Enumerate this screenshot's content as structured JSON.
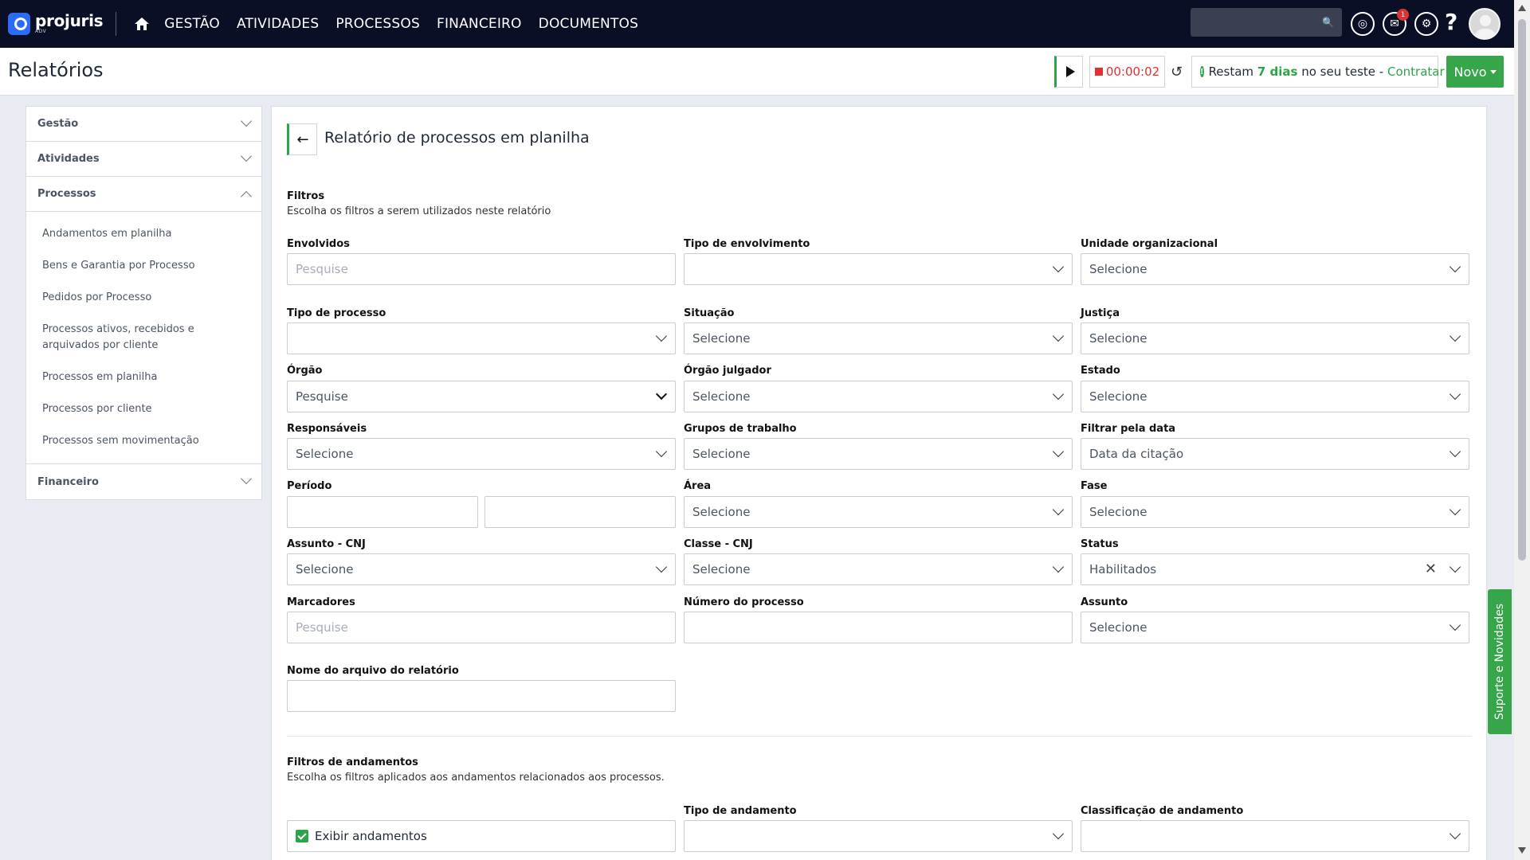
{
  "nav": {
    "brand": "projuris",
    "brand_sub": "ADV",
    "items": [
      "GESTÃO",
      "ATIVIDADES",
      "PROCESSOS",
      "FINANCEIRO",
      "DOCUMENTOS"
    ],
    "notifications_count": "1",
    "help": "?"
  },
  "header": {
    "title": "Relatórios",
    "timer": "00:00:02",
    "trial_prefix": "Restam",
    "trial_days": "7 dias",
    "trial_mid": "no seu teste -",
    "trial_link": "Contratar",
    "new_button": "Novo"
  },
  "sidebar": {
    "sections": [
      {
        "label": "Gestão"
      },
      {
        "label": "Atividades"
      },
      {
        "label": "Processos"
      },
      {
        "label": "Financeiro"
      }
    ],
    "processos_items": [
      "Andamentos em planilha",
      "Bens e Garantia por Processo",
      "Pedidos por Processo",
      "Processos ativos, recebidos e arquivados por cliente",
      "Processos em planilha",
      "Processos por cliente",
      "Processos sem movimentação"
    ]
  },
  "report": {
    "title": "Relatório de processos em planilha",
    "filters_title": "Filtros",
    "filters_sub": "Escolha os filtros a serem utilizados neste relatório",
    "labels": {
      "envolvidos": "Envolvidos",
      "tipo_envolvimento": "Tipo de envolvimento",
      "unidade_org": "Unidade organizacional",
      "tipo_processo": "Tipo de processo",
      "situacao": "Situação",
      "justica": "Justiça",
      "orgao": "Órgão",
      "orgao_julgador": "Órgão julgador",
      "estado": "Estado",
      "responsaveis": "Responsáveis",
      "grupos_trabalho": "Grupos de trabalho",
      "filtrar_data": "Filtrar pela data",
      "periodo": "Período",
      "area": "Área",
      "fase": "Fase",
      "assunto_cnj": "Assunto - CNJ",
      "classe_cnj": "Classe - CNJ",
      "status": "Status",
      "marcadores": "Marcadores",
      "numero_processo": "Número do processo",
      "assunto": "Assunto",
      "nome_arquivo": "Nome do arquivo do relatório"
    },
    "values": {
      "envolvidos_ph": "Pesquise",
      "unidade_org": "Selecione",
      "situacao": "Selecione",
      "justica": "Selecione",
      "orgao": "Pesquise",
      "orgao_julgador": "Selecione",
      "estado": "Selecione",
      "responsaveis": "Selecione",
      "grupos_trabalho": "Selecione",
      "filtrar_data": "Data da citação",
      "area": "Selecione",
      "fase": "Selecione",
      "assunto_cnj": "Selecione",
      "classe_cnj": "Selecione",
      "status": "Habilitados",
      "marcadores_ph": "Pesquise",
      "assunto": "Selecione"
    },
    "andamentos_title": "Filtros de andamentos",
    "andamentos_sub": "Escolha os filtros aplicados aos andamentos relacionados aos processos.",
    "tipo_andamento": "Tipo de andamento",
    "classificacao_andamento": "Classificação de andamento",
    "exibir_andamentos": "Exibir andamentos"
  },
  "support_tab": "Suporte e Novidades",
  "colors": {
    "topbar": "#0b0f25",
    "accent_green": "#37a64a",
    "timer_red": "#e0302f"
  }
}
